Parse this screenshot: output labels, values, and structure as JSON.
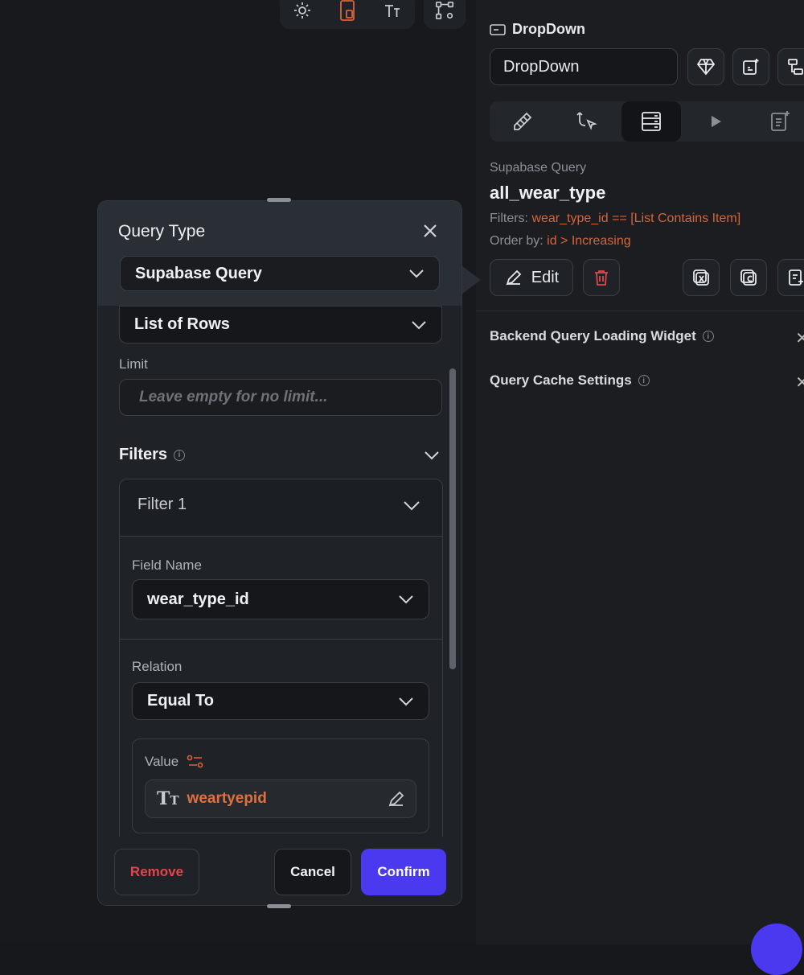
{
  "canvas": {
    "toolbar_icons": [
      "sun-icon",
      "device-frame-icon",
      "text-size-icon",
      "path-settings-icon"
    ]
  },
  "right_panel": {
    "widget_type": "DropDown",
    "widget_name_value": "DropDown",
    "tabs": [
      "properties-icon",
      "actions-icon",
      "backend-query-icon",
      "play-icon",
      "documentation-icon"
    ],
    "query": {
      "type_label": "Supabase Query",
      "table_name": "all_wear_type",
      "filters_label": "Filters:",
      "filters_value": "wear_type_id == [List Contains Item]",
      "order_label": "Order by:",
      "order_value": "id > Increasing",
      "edit_label": "Edit"
    },
    "sections": [
      {
        "label": "Backend Query Loading Widget"
      },
      {
        "label": "Query Cache Settings"
      }
    ]
  },
  "modal": {
    "title": "Query Type",
    "query_type_value": "Supabase Query",
    "return_type_value": "List of Rows",
    "limit_label": "Limit",
    "limit_placeholder": "Leave empty for no limit...",
    "filters_title": "Filters",
    "filter": {
      "title": "Filter 1",
      "field_name_label": "Field Name",
      "field_name_value": "wear_type_id",
      "relation_label": "Relation",
      "relation_value": "Equal To",
      "value_label": "Value",
      "value_text": "weartyepid"
    },
    "buttons": {
      "remove": "Remove",
      "cancel": "Cancel",
      "confirm": "Confirm"
    }
  },
  "colors": {
    "accent": "#4b39ef",
    "danger": "#e0474c",
    "highlight": "#d8643a"
  }
}
